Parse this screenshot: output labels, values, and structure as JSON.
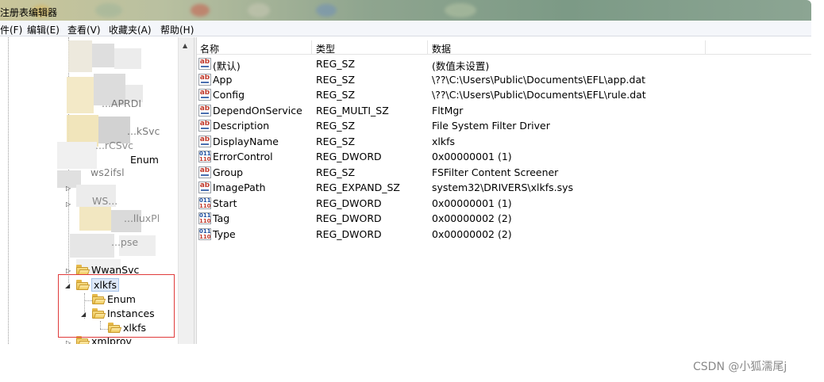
{
  "window": {
    "title": "注册表编辑器"
  },
  "menu": [
    {
      "label": "件(F)"
    },
    {
      "label": "编辑(E)"
    },
    {
      "label": "查看(V)"
    },
    {
      "label": "收藏夹(A)"
    },
    {
      "label": "帮助(H)"
    }
  ],
  "tree": {
    "blurred_labels": [
      "...APRDI",
      "...kSvc",
      "...rCSvc",
      "Enum",
      "ws2ifsl",
      "WS...",
      "...lluxPl",
      "...pse"
    ],
    "wwansvc": "WwanSvc",
    "xlkfs": "xlkfs",
    "enum": "Enum",
    "instances": "Instances",
    "instance_xlkfs": "xlkfs",
    "xmlprov": "xmlprov"
  },
  "list": {
    "columns": [
      "名称",
      "类型",
      "数据"
    ],
    "rows": [
      {
        "icon": "string-value-icon",
        "name": "(默认)",
        "type": "REG_SZ",
        "data": "(数值未设置)"
      },
      {
        "icon": "string-value-icon",
        "name": "App",
        "type": "REG_SZ",
        "data": "\\??\\C:\\Users\\Public\\Documents\\EFL\\app.dat"
      },
      {
        "icon": "string-value-icon",
        "name": "Config",
        "type": "REG_SZ",
        "data": "\\??\\C:\\Users\\Public\\Documents\\EFL\\rule.dat"
      },
      {
        "icon": "string-value-icon",
        "name": "DependOnService",
        "type": "REG_MULTI_SZ",
        "data": "FltMgr"
      },
      {
        "icon": "string-value-icon",
        "name": "Description",
        "type": "REG_SZ",
        "data": "File System Filter Driver"
      },
      {
        "icon": "string-value-icon",
        "name": "DisplayName",
        "type": "REG_SZ",
        "data": "xlkfs"
      },
      {
        "icon": "binary-value-icon",
        "name": "ErrorControl",
        "type": "REG_DWORD",
        "data": "0x00000001 (1)"
      },
      {
        "icon": "string-value-icon",
        "name": "Group",
        "type": "REG_SZ",
        "data": "FSFilter Content Screener"
      },
      {
        "icon": "string-value-icon",
        "name": "ImagePath",
        "type": "REG_EXPAND_SZ",
        "data": "system32\\DRIVERS\\xlkfs.sys"
      },
      {
        "icon": "binary-value-icon",
        "name": "Start",
        "type": "REG_DWORD",
        "data": "0x00000001 (1)"
      },
      {
        "icon": "binary-value-icon",
        "name": "Tag",
        "type": "REG_DWORD",
        "data": "0x00000002 (2)"
      },
      {
        "icon": "binary-value-icon",
        "name": "Type",
        "type": "REG_DWORD",
        "data": "0x00000002 (2)"
      }
    ]
  },
  "watermark": "CSDN @小狐濡尾j",
  "colors": {
    "highlight_border": "#e03b3b",
    "folder": "#e9bd4a",
    "selection": "#dde8f8"
  }
}
